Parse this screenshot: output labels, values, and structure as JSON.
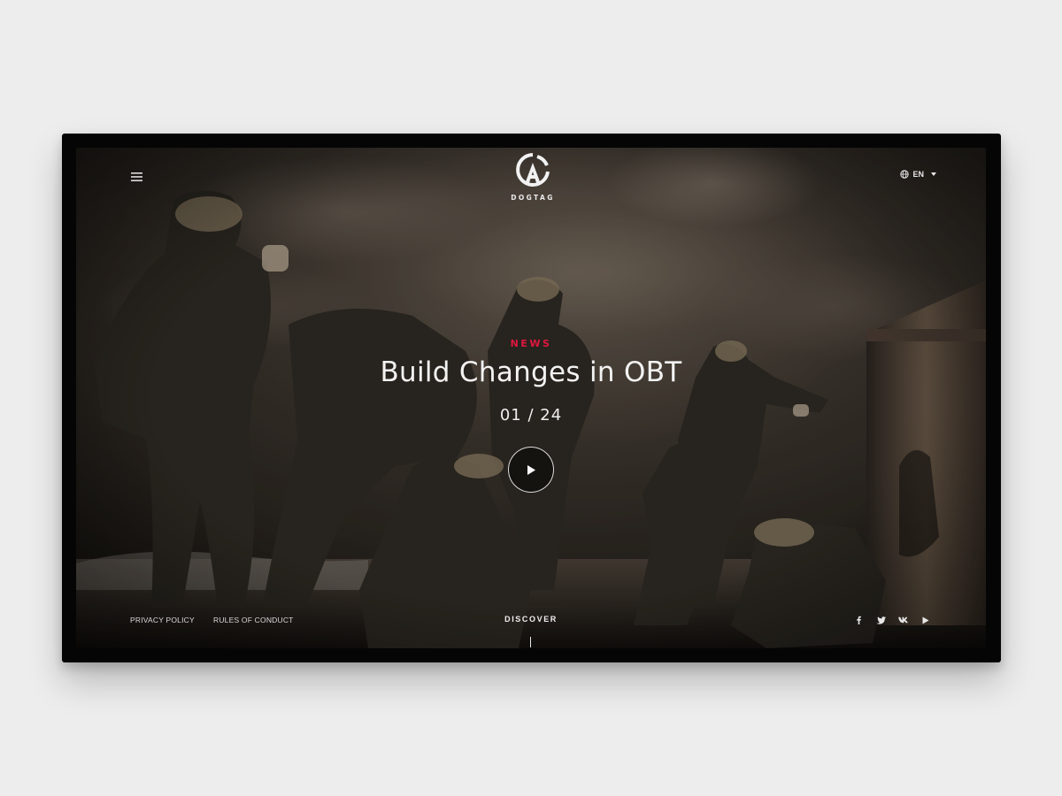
{
  "brand": {
    "logo_text": "DOGTAG"
  },
  "header": {
    "menu_icon": "hamburger-menu-icon",
    "language": "EN",
    "language_icon": "globe-icon"
  },
  "hero": {
    "kicker": "NEWS",
    "headline": "Build Changes in OBT",
    "counter": "01 / 24",
    "play_icon": "play-icon"
  },
  "footer": {
    "links": [
      "PRIVACY POLICY",
      "RULES OF CONDUCT"
    ],
    "discover": "DISCOVER",
    "socials": [
      "facebook-icon",
      "twitter-icon",
      "vk-icon",
      "youtube-icon"
    ]
  },
  "colors": {
    "accent": "#e0173f",
    "page_bg": "#ededed",
    "frame": "#050505"
  }
}
